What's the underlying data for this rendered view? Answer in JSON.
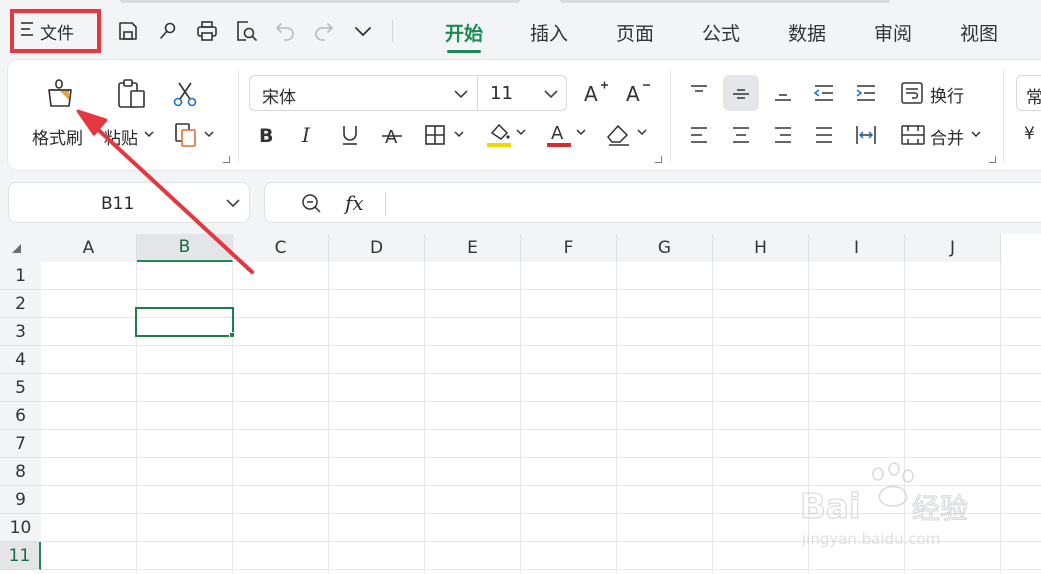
{
  "toolbar": {
    "file_label": "文件",
    "tabs": [
      {
        "label": "开始",
        "active": true
      },
      {
        "label": "插入",
        "active": false
      },
      {
        "label": "页面",
        "active": false
      },
      {
        "label": "公式",
        "active": false
      },
      {
        "label": "数据",
        "active": false
      },
      {
        "label": "审阅",
        "active": false
      },
      {
        "label": "视图",
        "active": false
      }
    ],
    "quick_access_icons": [
      "save-icon",
      "format-painter-mini-icon",
      "print-icon",
      "print-preview-icon",
      "undo-icon",
      "redo-icon",
      "chevron-down-icon"
    ]
  },
  "ribbon": {
    "format_painter_label": "格式刷",
    "paste_label": "粘贴",
    "font_name": "宋体",
    "font_size": "11",
    "wrap_label": "换行",
    "merge_label": "合并",
    "number_format_partial": "常",
    "currency_partial": "¥"
  },
  "formula_bar": {
    "name_box_value": "B11",
    "fx_label": "fx",
    "formula_value": ""
  },
  "sheet": {
    "columns": [
      "A",
      "B",
      "C",
      "D",
      "E",
      "F",
      "G",
      "H",
      "I",
      "J"
    ],
    "rows": [
      "1",
      "2",
      "3",
      "4",
      "5",
      "6",
      "7",
      "8",
      "9",
      "10",
      "11"
    ],
    "selected_column": "B",
    "selected_row": "11",
    "selected_cell": "B11"
  },
  "annotation": {
    "highlight_target": "文件",
    "arrow_target": "格式刷",
    "highlight_color": "#e5373f"
  },
  "watermark": {
    "brand": "Bai经验",
    "url": "jingyan.baidu.com"
  },
  "colors": {
    "accent": "#1b8a53",
    "selection": "#1e7e45",
    "annotation_red": "#e5373f",
    "fill_yellow": "#f2d600",
    "font_red": "#d32f2f"
  }
}
